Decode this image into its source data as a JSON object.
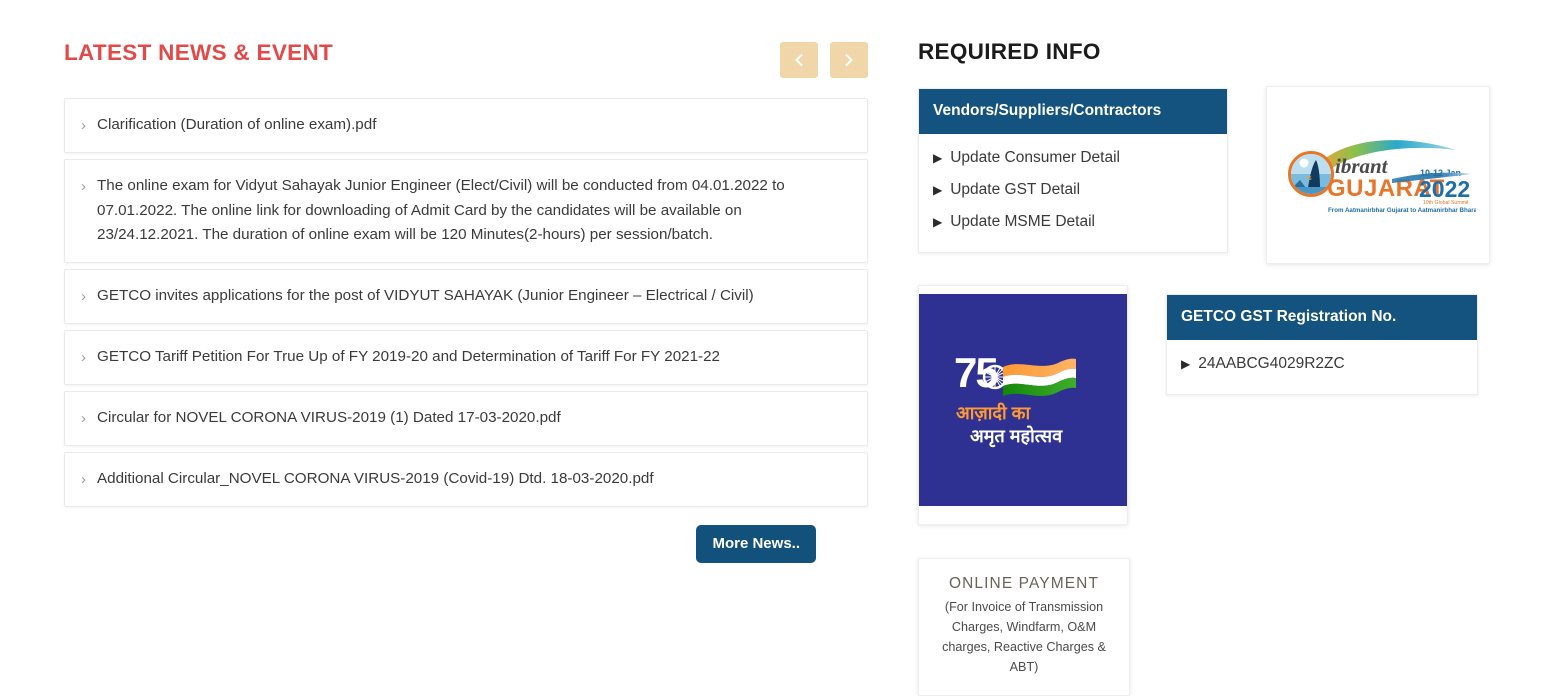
{
  "news": {
    "title": "LATEST NEWS & EVENT",
    "prev_icon": "chevron-left-icon",
    "next_icon": "chevron-right-icon",
    "items": [
      {
        "text": "Clarification (Duration of online exam).pdf"
      },
      {
        "text": "The online exam for Vidyut Sahayak Junior Engineer (Elect/Civil) will be conducted from 04.01.2022 to 07.01.2022. The online link for downloading of Admit Card by the candidates will be available on 23/24.12.2021. The duration of online exam will be 120 Minutes(2-hours) per session/batch."
      },
      {
        "text": "GETCO invites applications for the post of VIDYUT SAHAYAK (Junior Engineer – Electrical / Civil)"
      },
      {
        "text": "GETCO Tariff Petition For True Up of FY 2019-20 and Determination of Tariff For FY 2021-22"
      },
      {
        "text": "Circular for NOVEL CORONA VIRUS-2019 (1) Dated 17-03-2020.pdf"
      },
      {
        "text": "Additional Circular_NOVEL CORONA VIRUS-2019 (Covid-19) Dtd. 18-03-2020.pdf"
      }
    ],
    "chevron": "›",
    "more_button": "More News.."
  },
  "required_info": {
    "title": "REQUIRED INFO",
    "vendors_panel": {
      "heading": "Vendors/Suppliers/Contractors",
      "bullet": "▶",
      "links": [
        "Update Consumer Detail",
        "Update GST Detail",
        "Update MSME Detail"
      ]
    },
    "gst_panel": {
      "heading": "GETCO GST Registration No.",
      "bullet": "▶",
      "value": "24AABCG4029R2ZC"
    }
  },
  "gujarat_banner": {
    "name": "vibrant-gujarat-2022-logo",
    "word_vibrant": "ibrant",
    "word_gujarat": "GUJARAT",
    "year": "2022",
    "dates": "10-12 Jan",
    "summit": "10ᵗʰ Global Summit",
    "tagline": "From Aatmanirbhar Gujarat to Aatmanirbhar Bharat"
  },
  "azadi_banner": {
    "name": "azadi-ka-amrit-mahotsav-logo",
    "seventy_five": "75",
    "line1": "आज़ादी का",
    "line2": "अमृत महोत्सव",
    "background": "#2e3192"
  },
  "online_payment": {
    "title": "ONLINE PAYMENT",
    "subtitle": "(For Invoice of Transmission Charges, Windfarm, O&M charges, Reactive Charges & ABT)"
  },
  "colors": {
    "accent_red": "#e24a4a",
    "panel_blue": "#14527f",
    "button_blue": "#13517d",
    "nav_tan": "#f0d6a9",
    "azadi_indigo": "#2e3192"
  }
}
